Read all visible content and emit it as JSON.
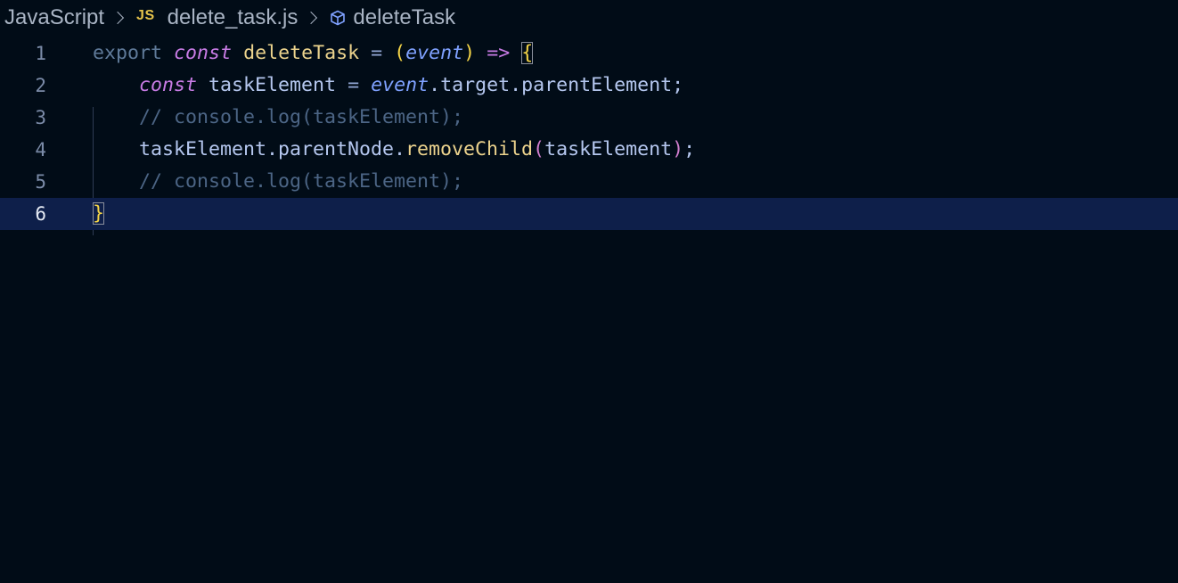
{
  "breadcrumb": {
    "language": "JavaScript",
    "file_icon": "JS",
    "file_name": "delete_task.js",
    "symbol_icon": "symbol-variable-icon",
    "symbol": "deleteTask"
  },
  "editor": {
    "current_line": 6,
    "lines": [
      {
        "number": "1",
        "tokens": [
          {
            "text": "export",
            "type": "export"
          },
          {
            "text": " ",
            "type": "space"
          },
          {
            "text": "const",
            "type": "keyword"
          },
          {
            "text": " ",
            "type": "space"
          },
          {
            "text": "deleteTask",
            "type": "function"
          },
          {
            "text": " ",
            "type": "space"
          },
          {
            "text": "=",
            "type": "operator"
          },
          {
            "text": " ",
            "type": "space"
          },
          {
            "text": "(",
            "type": "paren"
          },
          {
            "text": "event",
            "type": "param"
          },
          {
            "text": ")",
            "type": "paren"
          },
          {
            "text": " ",
            "type": "space"
          },
          {
            "text": "=>",
            "type": "arrow"
          },
          {
            "text": " ",
            "type": "space"
          },
          {
            "text": "{",
            "type": "brace-match"
          }
        ]
      },
      {
        "number": "2",
        "tokens": [
          {
            "text": "    ",
            "type": "space"
          },
          {
            "text": "const",
            "type": "keyword"
          },
          {
            "text": " ",
            "type": "space"
          },
          {
            "text": "taskElement",
            "type": "variable"
          },
          {
            "text": " ",
            "type": "space"
          },
          {
            "text": "=",
            "type": "operator"
          },
          {
            "text": " ",
            "type": "space"
          },
          {
            "text": "event",
            "type": "param"
          },
          {
            "text": ".target.parentElement;",
            "type": "property"
          }
        ]
      },
      {
        "number": "3",
        "tokens": [
          {
            "text": "    ",
            "type": "space"
          },
          {
            "text": "// console.log(taskElement);",
            "type": "comment"
          }
        ]
      },
      {
        "number": "4",
        "tokens": [
          {
            "text": "    ",
            "type": "space"
          },
          {
            "text": "taskElement.parentNode.",
            "type": "variable"
          },
          {
            "text": "removeChild",
            "type": "method"
          },
          {
            "text": "(",
            "type": "paren-m"
          },
          {
            "text": "taskElement",
            "type": "variable"
          },
          {
            "text": ")",
            "type": "paren-m"
          },
          {
            "text": ";",
            "type": "punct"
          }
        ]
      },
      {
        "number": "5",
        "tokens": [
          {
            "text": "    ",
            "type": "space"
          },
          {
            "text": "// console.log(taskElement);",
            "type": "comment"
          }
        ]
      },
      {
        "number": "6",
        "tokens": [
          {
            "text": "}",
            "type": "brace-match"
          }
        ]
      }
    ]
  },
  "colors": {
    "background": "#010c17",
    "current_line": "#0e1f4a",
    "keyword": "#c97ce6",
    "function": "#ecd38d",
    "param": "#7fa1ff",
    "comment": "#4c6585"
  }
}
